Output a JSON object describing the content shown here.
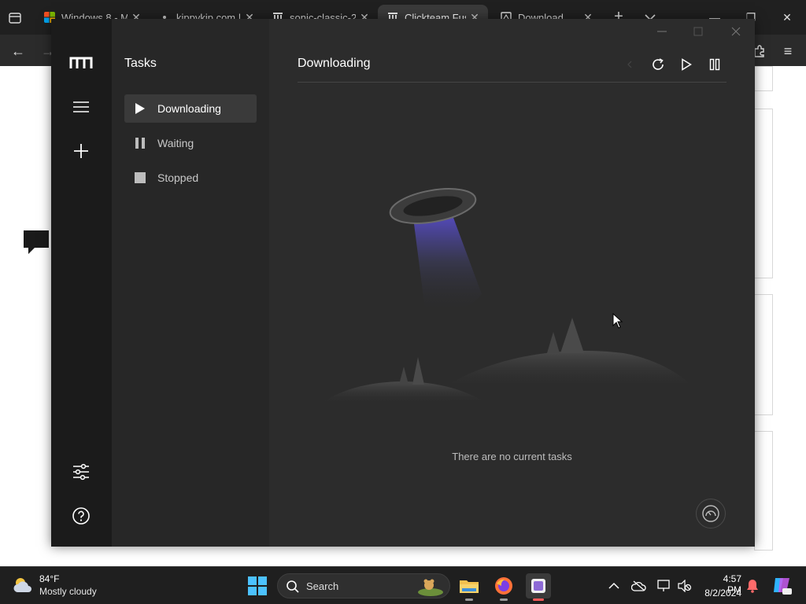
{
  "browser": {
    "tabs": [
      {
        "label": "Windows 8 - M",
        "active": false
      },
      {
        "label": "kippykip.com | -",
        "active": false
      },
      {
        "label": "sonic-classic-2-",
        "active": false
      },
      {
        "label": "Clickteam Fusi",
        "active": true
      },
      {
        "label": "Download",
        "active": false
      }
    ],
    "new_tab": "+"
  },
  "app": {
    "nav_title": "Tasks",
    "nav_items": [
      {
        "label": "Downloading",
        "icon": "play-icon"
      },
      {
        "label": "Waiting",
        "icon": "pause-icon"
      },
      {
        "label": "Stopped",
        "icon": "stop-icon"
      }
    ],
    "content_title": "Downloading",
    "empty_message": "There are no current tasks",
    "colors": {
      "rail": "#1b1b1b",
      "nav": "#272727",
      "content": "#2c2c2c",
      "beam": "#5b4fd6"
    }
  },
  "taskbar": {
    "weather_temp": "84°F",
    "weather_desc": "Mostly cloudy",
    "search_placeholder": "Search",
    "time": "4:57 PM",
    "date": "8/2/2024"
  }
}
